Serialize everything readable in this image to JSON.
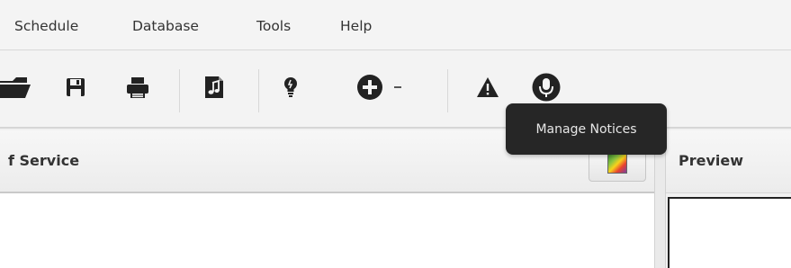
{
  "menubar": {
    "items": [
      {
        "label": "Schedule"
      },
      {
        "label": "Database"
      },
      {
        "label": "Tools"
      },
      {
        "label": "Help"
      }
    ]
  },
  "toolbar": {
    "buttons": [
      {
        "icon": "folder-open-icon"
      },
      {
        "icon": "save-icon"
      },
      {
        "icon": "print-icon"
      },
      {
        "icon": "music-file-icon"
      },
      {
        "icon": "lightbulb-icon"
      },
      {
        "icon": "add-circle-icon"
      },
      {
        "icon": "dropdown-arrow-icon"
      },
      {
        "icon": "warning-icon"
      },
      {
        "icon": "microphone-icon"
      }
    ]
  },
  "service_panel": {
    "title": "f Service",
    "theme_button_icon": "color-palette-icon"
  },
  "preview_panel": {
    "title": "Preview"
  },
  "tooltip": {
    "text": "Manage Notices"
  },
  "colors": {
    "icon": "#222222",
    "tooltip_bg": "#262626",
    "tooltip_text": "#e6e6e6"
  }
}
